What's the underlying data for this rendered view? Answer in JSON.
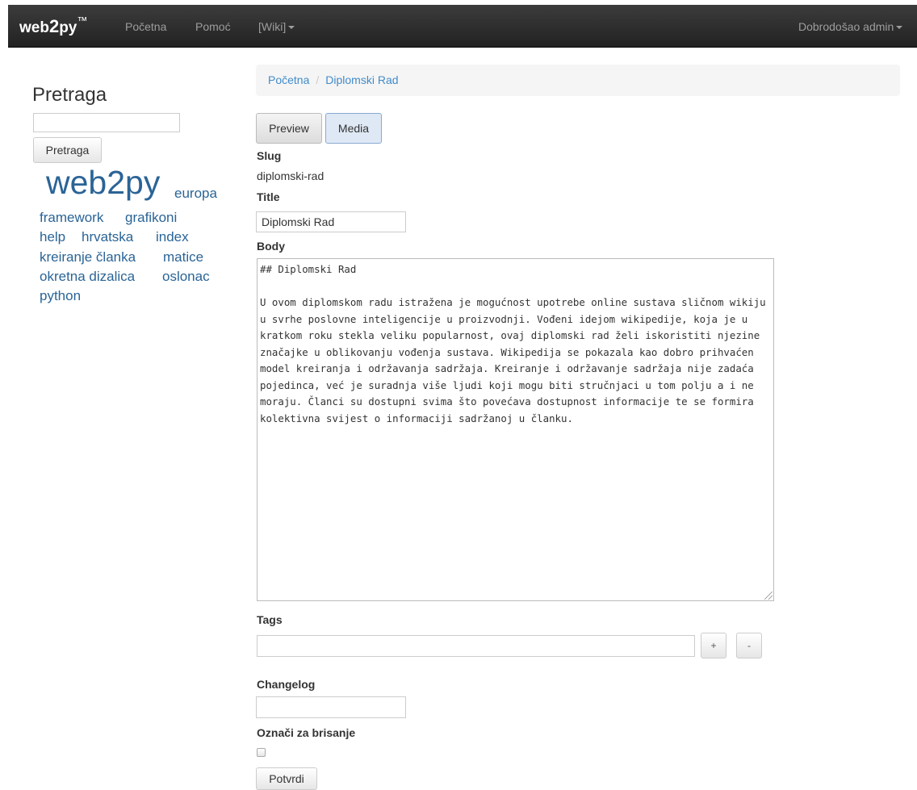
{
  "navbar": {
    "brand": {
      "prefix": "web",
      "two": "2",
      "suffix": "py",
      "tm": "™"
    },
    "links": [
      "Početna",
      "Pomoć",
      "[Wiki]"
    ],
    "user_menu": "Dobrodošao admin"
  },
  "sidebar": {
    "title": "Pretraga",
    "search_placeholder": "",
    "search_button": "Pretraga",
    "tags": [
      "web2py",
      "europa",
      "framework",
      "grafikoni",
      "help",
      "hrvatska",
      "index",
      "kreiranje članka",
      "matice",
      "okretna dizalica",
      "oslonac",
      "python"
    ]
  },
  "breadcrumb": {
    "home": "Početna",
    "separator": "/",
    "current": "Diplomski Rad"
  },
  "tabs": [
    "Preview",
    "Media"
  ],
  "form": {
    "slug_label": "Slug",
    "slug_value": "diplomski-rad",
    "title_label": "Title",
    "title_value": "Diplomski Rad",
    "body_label": "Body",
    "body_value": "## Diplomski Rad\n\nU ovom diplomskom radu istražena je mogućnost upotrebe online sustava sličnom wikiju u svrhe poslovne inteligencije u proizvodnji. Vođeni idejom wikipedije, koja je u kratkom roku stekla veliku popularnost, ovaj diplomski rad želi iskoristiti njezine značajke u oblikovanju vođenja sustava. Wikipedija se pokazala kao dobro prihvaćen model kreiranja i održavanja sadržaja. Kreiranje i održavanje sadržaja nije zadaća pojedinca, već je suradnja više ljudi koji mogu biti stručnjaci u tom polju a i ne moraju. Članci su dostupni svima što povećava dostupnost informacije te se formira kolektivna svijest o informaciji sadržanoj u članku.",
    "tags_label": "Tags",
    "tags_value": "",
    "add_tag": "+",
    "remove_tag": "-",
    "changelog_label": "Changelog",
    "changelog_value": "",
    "delete_label": "Označi za brisanje",
    "submit": "Potvrdi"
  }
}
